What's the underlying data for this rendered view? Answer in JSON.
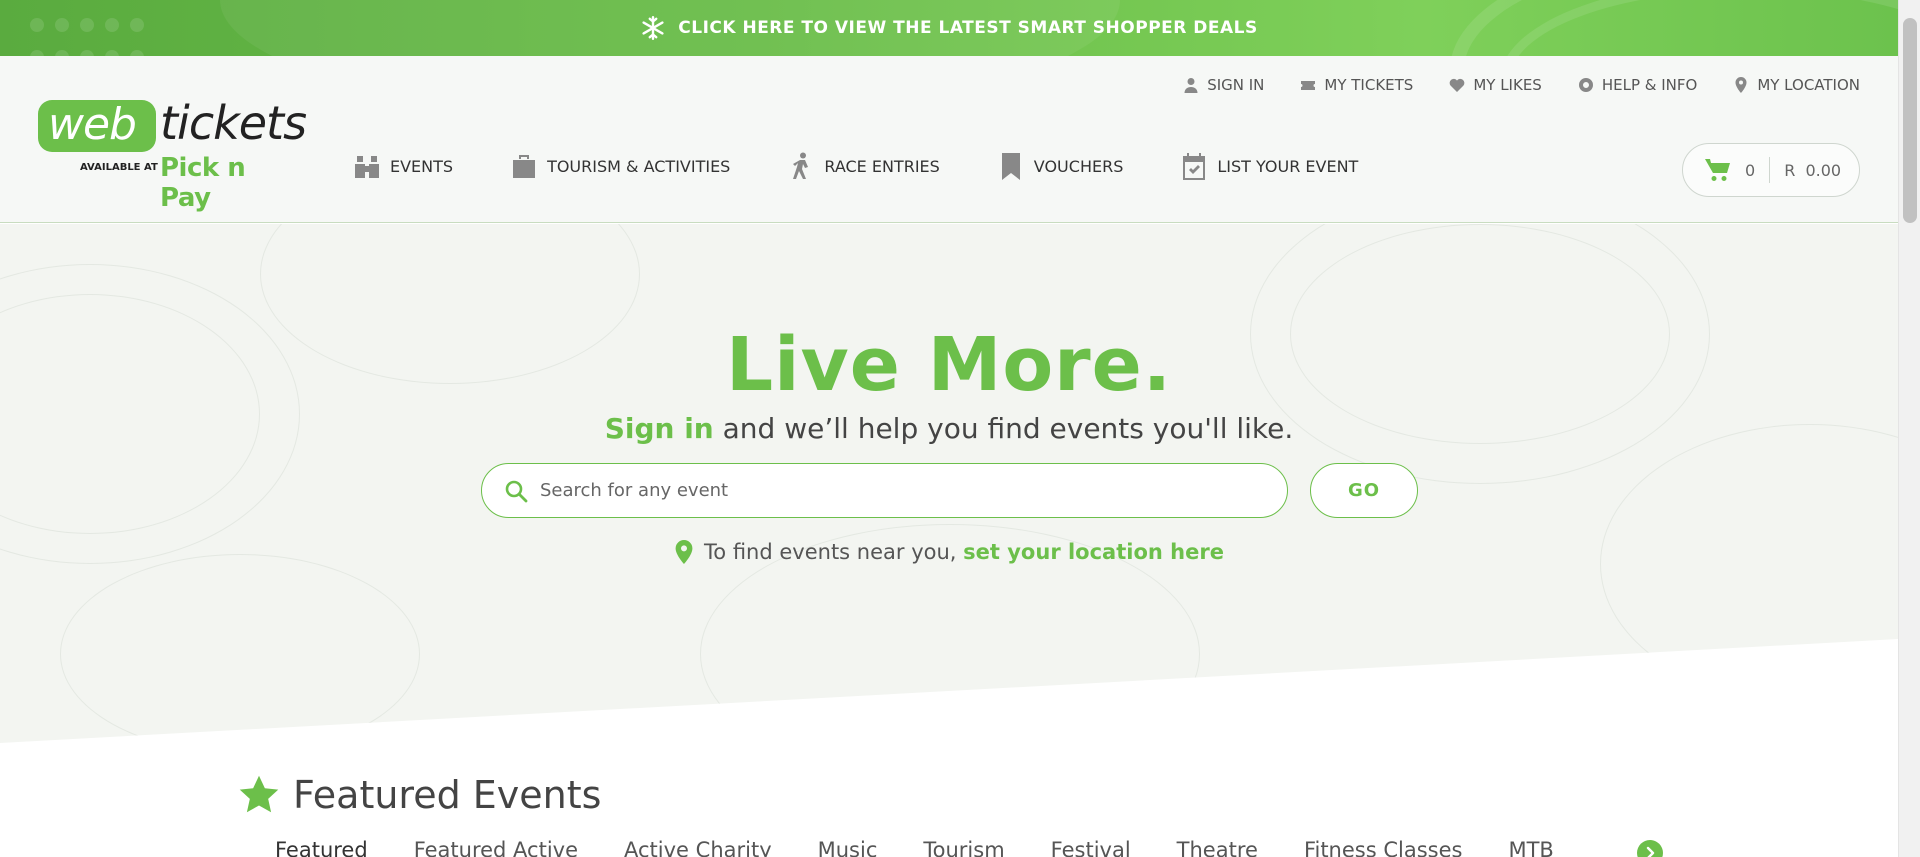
{
  "promo": {
    "text": "CLICK HERE TO VIEW THE LATEST SMART SHOPPER DEALS",
    "icon": "snowflake-icon"
  },
  "logo": {
    "web": "web",
    "tickets": "tickets",
    "available": "AVAILABLE AT",
    "partner": "Pick n Pay"
  },
  "util_nav": [
    {
      "label": "SIGN IN",
      "icon": "user-icon"
    },
    {
      "label": "MY TICKETS",
      "icon": "ticket-icon"
    },
    {
      "label": "MY LIKES",
      "icon": "heart-icon"
    },
    {
      "label": "HELP & INFO",
      "icon": "lifebuoy-icon"
    },
    {
      "label": "MY LOCATION",
      "icon": "location-pin-icon"
    }
  ],
  "main_nav": [
    {
      "label": "EVENTS",
      "icon": "binoculars-icon"
    },
    {
      "label": "TOURISM & ACTIVITIES",
      "icon": "suitcase-icon"
    },
    {
      "label": "RACE ENTRIES",
      "icon": "runner-icon"
    },
    {
      "label": "VOUCHERS",
      "icon": "bookmark-icon"
    },
    {
      "label": "LIST YOUR EVENT",
      "icon": "calendar-check-icon"
    }
  ],
  "cart": {
    "count": "0",
    "total": "R  0.00",
    "icon": "cart-icon"
  },
  "hero": {
    "title": "Live More.",
    "signin_link": "Sign in",
    "subtitle_rest": " and we’ll help you find events you'll like.",
    "search_placeholder": "Search for any event",
    "search_value": "",
    "go_label": "GO",
    "location_text": "To find events near you, ",
    "location_link": "set your location here"
  },
  "featured": {
    "title": "Featured Events",
    "tabs": [
      "Featured",
      "Featured Active",
      "Active Charity",
      "Music",
      "Tourism",
      "Festival",
      "Theatre",
      "Fitness Classes",
      "MTB"
    ]
  },
  "colors": {
    "brand_green": "#6cbf4a",
    "header_bg": "#f6f8f6",
    "hero_bg": "#f3f5f1"
  }
}
